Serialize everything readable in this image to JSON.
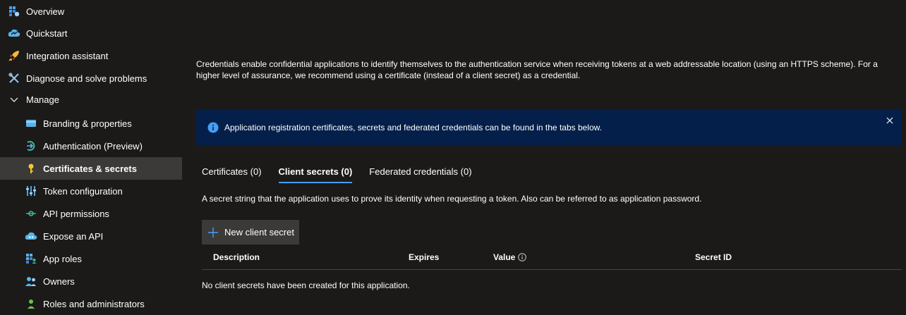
{
  "sidebar": {
    "items": [
      {
        "label": "Overview",
        "icon": "overview-icon"
      },
      {
        "label": "Quickstart",
        "icon": "quickstart-icon"
      },
      {
        "label": "Integration assistant",
        "icon": "rocket-icon"
      },
      {
        "label": "Diagnose and solve problems",
        "icon": "wrench-icon"
      },
      {
        "label": "Manage",
        "icon": "chevron-down-icon"
      },
      {
        "label": "Branding & properties",
        "icon": "branding-icon"
      },
      {
        "label": "Authentication (Preview)",
        "icon": "authentication-icon"
      },
      {
        "label": "Certificates & secrets",
        "icon": "key-icon",
        "active": true
      },
      {
        "label": "Token configuration",
        "icon": "token-config-icon"
      },
      {
        "label": "API permissions",
        "icon": "api-permissions-icon"
      },
      {
        "label": "Expose an API",
        "icon": "cloud-api-icon"
      },
      {
        "label": "App roles",
        "icon": "app-roles-icon"
      },
      {
        "label": "Owners",
        "icon": "owners-icon"
      },
      {
        "label": "Roles and administrators",
        "icon": "roles-icon"
      }
    ]
  },
  "main": {
    "intro": "Credentials enable confidential applications to identify themselves to the authentication service when receiving tokens at a web addressable location (using an HTTPS scheme). For a higher level of assurance, we recommend using a certificate (instead of a client secret) as a credential.",
    "banner": {
      "text": "Application registration certificates, secrets and federated credentials can be found in the tabs below.",
      "icon": "info-icon",
      "close_icon": "close-icon"
    },
    "tabs": [
      {
        "label": "Certificates (0)"
      },
      {
        "label": "Client secrets (0)",
        "selected": true
      },
      {
        "label": "Federated credentials (0)"
      }
    ],
    "description": "A secret string that the application uses to prove its identity when requesting a token. Also can be referred to as application password.",
    "new_button": "New client secret",
    "table": {
      "columns": [
        "Description",
        "Expires",
        "Value",
        "Secret ID"
      ],
      "empty_message": "No client secrets have been created for this application."
    }
  },
  "colors": {
    "background": "#1b1a19",
    "active_item": "#3b3a39",
    "banner": "#04204a",
    "accent": "#479ef5"
  }
}
